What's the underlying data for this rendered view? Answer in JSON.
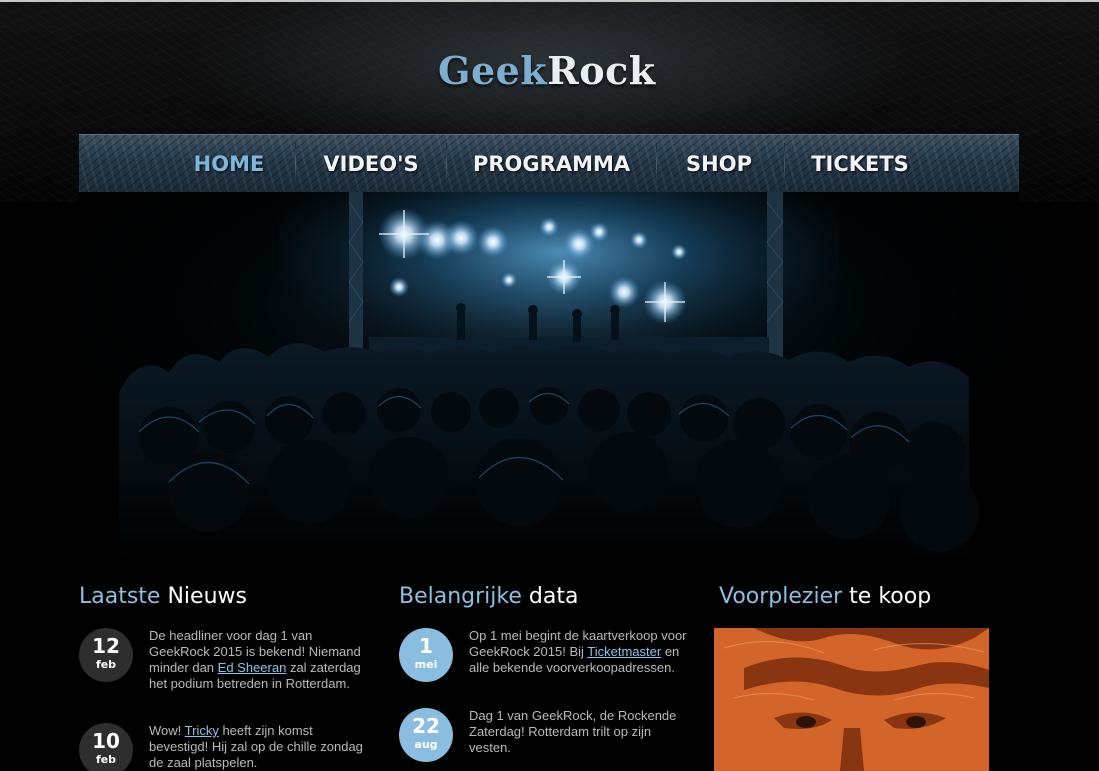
{
  "site": {
    "logo_part1": "Geek",
    "logo_part2": "Rock"
  },
  "nav": {
    "items": [
      {
        "label": "HOME",
        "active": true
      },
      {
        "label": "VIDEO'S",
        "active": false
      },
      {
        "label": "PROGRAMMA",
        "active": false
      },
      {
        "label": "SHOP",
        "active": false
      },
      {
        "label": "TICKETS",
        "active": false
      }
    ]
  },
  "colors": {
    "accent": "#8dbfe0",
    "nav_active": "#7fb7dc",
    "album_orange": "#d4652a"
  },
  "news": {
    "title_highlight": "Laatste",
    "title_rest": "Nieuws",
    "items": [
      {
        "day": "12",
        "month": "feb",
        "text_before": "De headliner voor dag 1 van GeekRock 2015 is bekend! Niemand minder dan ",
        "link": "Ed Sheeran",
        "text_after": " zal zaterdag het podium betreden in Rotterdam."
      },
      {
        "day": "10",
        "month": "feb",
        "text_before": "Wow! ",
        "link": "Tricky",
        "text_after": " heeft zijn komst bevestigd! Hij zal op de chille zondag de zaal platspelen."
      }
    ]
  },
  "dates": {
    "title_highlight": "Belangrijke",
    "title_rest": "data",
    "items": [
      {
        "day": "1",
        "month": "mei",
        "text_before": "Op 1 mei begint de kaartverkoop voor GeekRock 2015! Bij ",
        "link": "Ticketmaster",
        "text_after": " en alle bekende voorverkoopadressen."
      },
      {
        "day": "22",
        "month": "aug",
        "text_before": "Dag 1 van GeekRock, de Rockende Zaterdag! Rotterdam trilt op zijn vesten.",
        "link": "",
        "text_after": ""
      }
    ]
  },
  "shop": {
    "title_highlight": "Voorplezier",
    "title_rest": "te koop"
  }
}
